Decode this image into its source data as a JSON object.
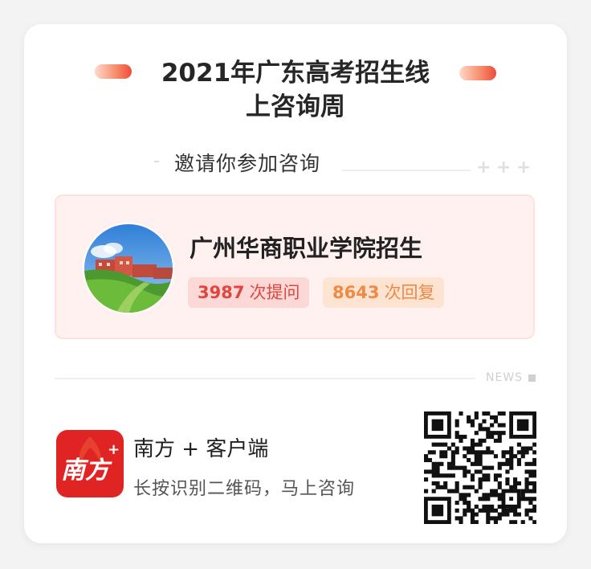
{
  "header": {
    "title_line1": "2021年广东高考招生线",
    "title_line2": "上咨询周",
    "invite_text": "邀请你参加咨询",
    "plus_marks": "+ + +"
  },
  "organization": {
    "name": "广州华商职业学院招生",
    "avatar_icon": "campus-photo",
    "questions_count": "3987",
    "questions_label": "次提问",
    "replies_count": "8643",
    "replies_label": "次回复"
  },
  "news": {
    "label": "NEWS"
  },
  "footer": {
    "app_name": "南方 + 客户端",
    "app_subtitle": "长按识别二维码，马上咨询",
    "app_logo_text": "南方",
    "app_logo_plus": "+",
    "qr_icon": "qr-code"
  },
  "colors": {
    "accent_red": "#e0463d",
    "accent_orange": "#ee8a43",
    "app_red": "#e02424",
    "card_pink": "#fff1f0"
  }
}
